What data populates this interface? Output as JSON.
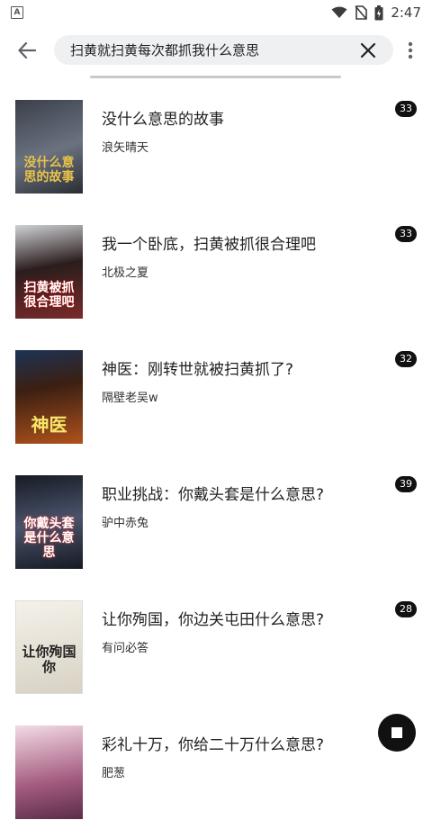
{
  "status": {
    "time": "2:47",
    "icons": [
      "a-notification-icon",
      "wifi-icon",
      "no-sim-icon",
      "battery-icon"
    ]
  },
  "search": {
    "query": "扫黄就扫黄每次都抓我什么意思"
  },
  "books": [
    {
      "title": "没什么意思的故事",
      "author": "浪矢晴天",
      "count": "33",
      "cover_text": "没什么意思的故事",
      "cover_colors": [
        "#3a3f4a",
        "#6b7280"
      ]
    },
    {
      "title": "我一个卧底，扫黄被抓很合理吧",
      "author": "北极之夏",
      "count": "33",
      "cover_text": "扫黄被抓很合理吧",
      "cover_colors": [
        "#2b1d1d",
        "#7a2a2a"
      ]
    },
    {
      "title": "神医：刚转世就被扫黄抓了?",
      "author": "隔壁老吴w",
      "count": "32",
      "cover_text": "神医",
      "cover_colors": [
        "#3b1f12",
        "#b0521c"
      ]
    },
    {
      "title": "职业挑战：你戴头套是什么意思?",
      "author": "驴中赤兔",
      "count": "39",
      "cover_text": "你戴头套是什么意思",
      "cover_colors": [
        "#161a24",
        "#4a536a"
      ]
    },
    {
      "title": "让你殉国，你边关屯田什么意思?",
      "author": "有问必答",
      "count": "28",
      "cover_text": "让你殉国你",
      "cover_colors": [
        "#f4f1ea",
        "#d8d2c4"
      ]
    },
    {
      "title": "彩礼十万，你给二十万什么意思?",
      "author": "肥葱",
      "count": "",
      "cover_text": "",
      "cover_colors": [
        "#e7c7d6",
        "#a35b7e"
      ]
    }
  ]
}
